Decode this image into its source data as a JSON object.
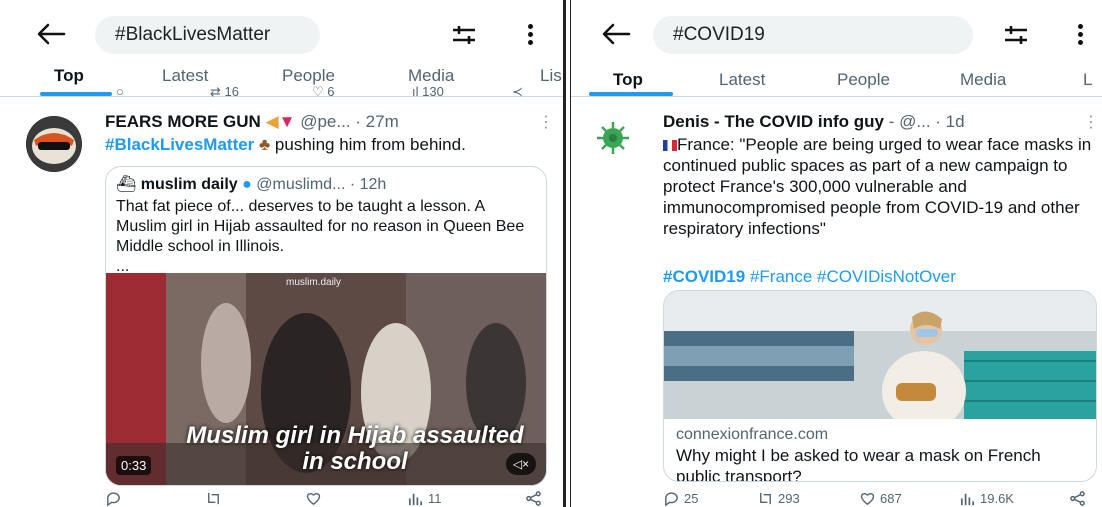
{
  "left": {
    "search": {
      "query": "#BlackLivesMatter"
    },
    "tabs": [
      "Top",
      "Latest",
      "People",
      "Media",
      "Lis"
    ],
    "prev_actions": {
      "retweets": "16",
      "likes": "6",
      "views": "130"
    },
    "tweet": {
      "name": "FEARS MORE GUN",
      "handle": "@pe...",
      "time": "· 27m",
      "hashtag": "#BlackLivesMatter",
      "text_after": " pushing him from behind.",
      "quote": {
        "name": "muslim daily",
        "handle": "@muslimd...",
        "time": "· 12h",
        "text": "That fat piece of... deserves to be taught a lesson. A Muslim girl in Hijab assaulted for no reason in Queen Bee Middle school in Illinois.",
        "ellipsis": "...",
        "video": {
          "watermark": "muslim.daily",
          "caption": "Muslim girl in Hijab assaulted in school",
          "duration": "0:33",
          "mute_label": "◁×"
        }
      },
      "actions": {
        "replies": "",
        "retweets": "",
        "likes": "",
        "views": "11"
      }
    }
  },
  "right": {
    "search": {
      "query": "#COVID19"
    },
    "tabs": [
      "Top",
      "Latest",
      "People",
      "Media",
      "L"
    ],
    "tweet": {
      "name": "Denis - The COVID info guy",
      "handle": "- @...",
      "time": "· 1d",
      "text": "France: \"People are being urged to wear face masks in continued public spaces as part of a new campaign to protect France's 300,000 vulnerable and immunocompromised people from COVID-19 and other respiratory infections\"",
      "hashtags": [
        "#COVID19",
        "#France",
        "#COVIDisNotOver"
      ],
      "link": {
        "domain": "connexionfrance.com",
        "title": "Why might I be asked to wear a mask on French public transport?"
      },
      "actions": {
        "replies": "25",
        "retweets": "293",
        "likes": "687",
        "views": "19.6K"
      }
    }
  },
  "colors": {
    "accent": "#1d9bf0",
    "text": "#0f1419",
    "muted": "#536471",
    "pill": "#eff3f4"
  }
}
